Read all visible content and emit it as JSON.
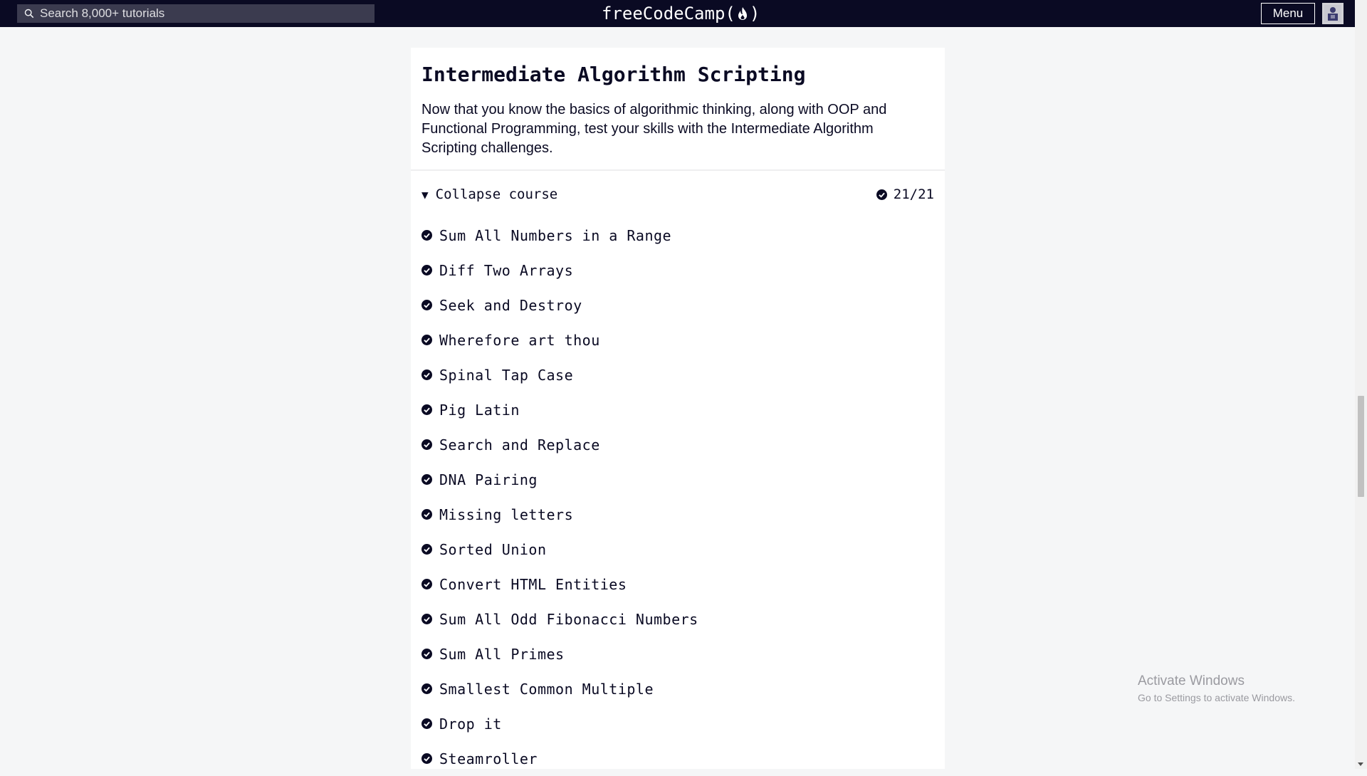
{
  "navbar": {
    "search_placeholder": "Search 8,000+ tutorials",
    "logo_text_left": "freeCodeCamp(",
    "logo_text_right": ")",
    "menu_label": "Menu"
  },
  "course": {
    "title": "Intermediate Algorithm Scripting",
    "description": "Now that you know the basics of algorithmic thinking, along with OOP and Functional Programming, test your skills with the Intermediate Algorithm Scripting challenges.",
    "toggle_label": "Collapse course",
    "progress": "21/21",
    "challenges": [
      {
        "label": "Sum All Numbers in a Range",
        "completed": true
      },
      {
        "label": "Diff Two Arrays",
        "completed": true
      },
      {
        "label": "Seek and Destroy",
        "completed": true
      },
      {
        "label": "Wherefore art thou",
        "completed": true
      },
      {
        "label": "Spinal Tap Case",
        "completed": true
      },
      {
        "label": "Pig Latin",
        "completed": true
      },
      {
        "label": "Search and Replace",
        "completed": true
      },
      {
        "label": "DNA Pairing",
        "completed": true
      },
      {
        "label": "Missing letters",
        "completed": true
      },
      {
        "label": "Sorted Union",
        "completed": true
      },
      {
        "label": "Convert HTML Entities",
        "completed": true
      },
      {
        "label": "Sum All Odd Fibonacci Numbers",
        "completed": true
      },
      {
        "label": "Sum All Primes",
        "completed": true
      },
      {
        "label": "Smallest Common Multiple",
        "completed": true
      },
      {
        "label": "Drop it",
        "completed": true
      },
      {
        "label": "Steamroller",
        "completed": true
      }
    ]
  },
  "watermark": {
    "line1": "Activate Windows",
    "line2": "Go to Settings to activate Windows."
  },
  "icons": {
    "search": "search-icon",
    "flame": "flame-icon",
    "avatar": "avatar-icon",
    "check": "check-circle-icon",
    "triangle": "triangle-down-icon"
  },
  "colors": {
    "navbar_bg": "#0a0a23",
    "page_bg": "#f5f6f7",
    "text": "#0a0a23"
  }
}
